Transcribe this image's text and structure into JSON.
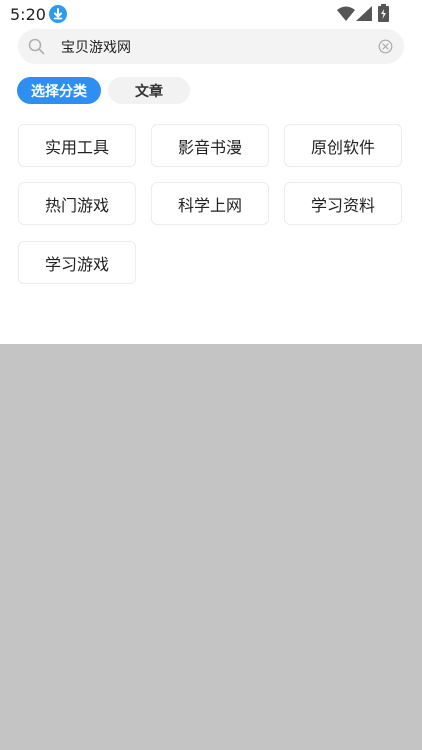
{
  "status": {
    "time": "5:20",
    "icons": [
      "download-icon",
      "wifi-icon",
      "signal-icon",
      "battery-charging-icon"
    ],
    "download_color": "#2d9cf0"
  },
  "search": {
    "value": "宝贝游戏网",
    "icon": "search-icon",
    "clear_icon": "clear-icon"
  },
  "tabs": [
    {
      "label": "选择分类",
      "active": true
    },
    {
      "label": "文章",
      "active": false
    }
  ],
  "categories": [
    {
      "label": "实用工具"
    },
    {
      "label": "影音书漫"
    },
    {
      "label": "原创软件"
    },
    {
      "label": "热门游戏"
    },
    {
      "label": "科学上网"
    },
    {
      "label": "学习资料"
    },
    {
      "label": "学习游戏"
    }
  ],
  "colors": {
    "accent": "#2e8ff0",
    "overlay": "#c4c4c4"
  }
}
